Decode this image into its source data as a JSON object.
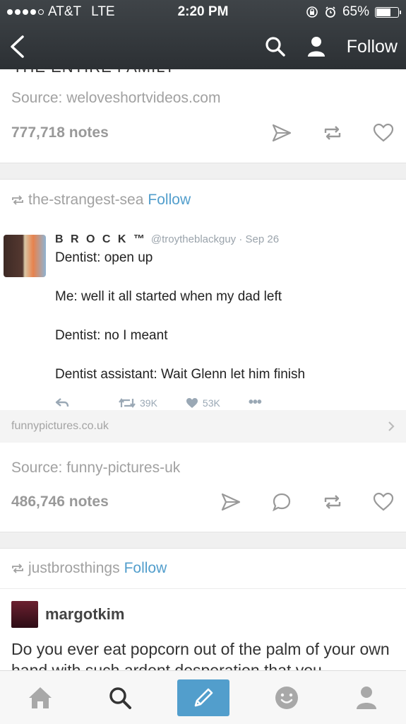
{
  "status_bar": {
    "carrier": "AT&T",
    "network": "LTE",
    "time": "2:20 PM",
    "battery": "65%",
    "battery_level": 0.65
  },
  "nav": {
    "follow_label": "Follow",
    "back_icon": "chevron-left-icon",
    "search_icon": "search-icon",
    "account_icon": "person-icon"
  },
  "post1": {
    "clipped_text": "THE ENTIRE FAMILY",
    "source": "Source: weloveshortvideos.com",
    "notes": "777,718 notes"
  },
  "post2": {
    "reblogger": "the-strangest-sea",
    "follow_label": "Follow",
    "tweet": {
      "name": "B R O C K ™",
      "handle": "@troytheblackguy · Sep 26",
      "lines": [
        "Dentist: open up",
        "Me: well it all started when my dad left",
        "Dentist: no I meant",
        "Dentist assistant: Wait Glenn let him finish"
      ],
      "retweets": "39K",
      "likes": "53K"
    },
    "link_domain": "funnypictures.co.uk",
    "source": "Source: funny-pictures-uk",
    "notes": "486,746 notes"
  },
  "post3": {
    "reblogger": "justbrosthings",
    "follow_label": "Follow",
    "author": "margotkim",
    "text": "Do you ever eat popcorn out of the palm of your own hand with such ardent desperation that you"
  },
  "tabbar": {
    "items": [
      "home-icon",
      "search-icon",
      "compose-icon",
      "smiley-icon",
      "person-icon"
    ],
    "accent": "#529ecc"
  }
}
